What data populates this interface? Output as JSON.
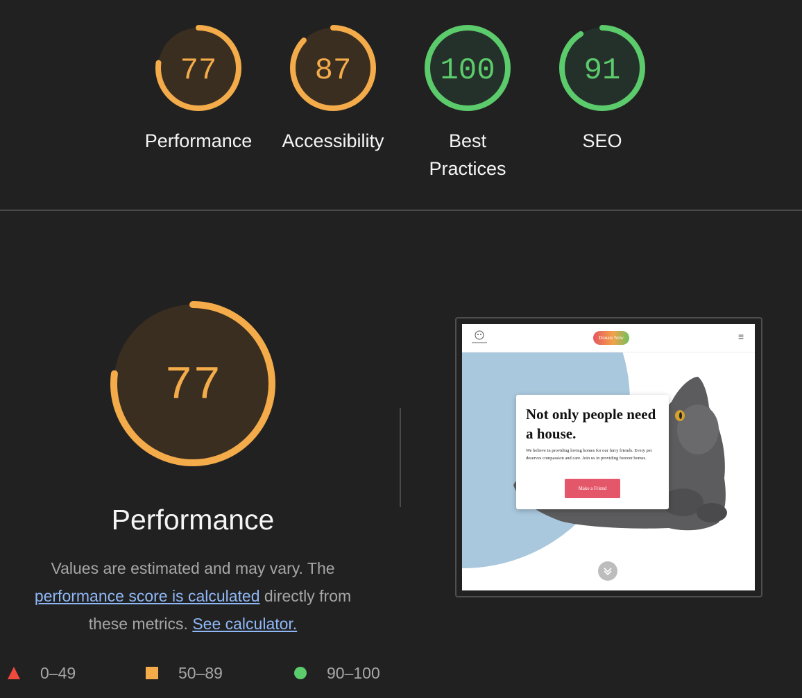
{
  "scores": [
    {
      "id": "performance",
      "value": 77,
      "label": "Performance",
      "status": "average"
    },
    {
      "id": "accessibility",
      "value": 87,
      "label": "Accessibility",
      "status": "average"
    },
    {
      "id": "best-practices",
      "value": 100,
      "label": "Best Practices",
      "status": "pass"
    },
    {
      "id": "seo",
      "value": 91,
      "label": "SEO",
      "status": "pass"
    }
  ],
  "performance_section": {
    "score": 77,
    "title": "Performance",
    "description_start": "Values are estimated and may vary. The ",
    "link_score": "performance score is calculated",
    "description_mid": " directly from these metrics. ",
    "link_calculator": "See calculator."
  },
  "legend": [
    {
      "range": "0–49",
      "icon": "red-triangle-icon",
      "color": "#ff4e42"
    },
    {
      "range": "50–89",
      "icon": "orange-square-icon",
      "color": "#ffa400"
    },
    {
      "range": "90–100",
      "icon": "green-circle-icon",
      "color": "#0cce6b"
    }
  ],
  "thumbnail": {
    "donate_button": "Donate Now",
    "headline": "Not only people need a house.",
    "body": "We believe in providing loving homes for our furry friends. Every pet deserves compassion and care. Join us in providing forever homes.",
    "cta_button": "Make a Friend"
  },
  "colors": {
    "average": "#f4ab4a",
    "average_bg": "#3a2e20",
    "pass": "#5bcb6b",
    "pass_bg": "#24312a",
    "fail": "#e8413a",
    "link": "#8fb8f8"
  }
}
